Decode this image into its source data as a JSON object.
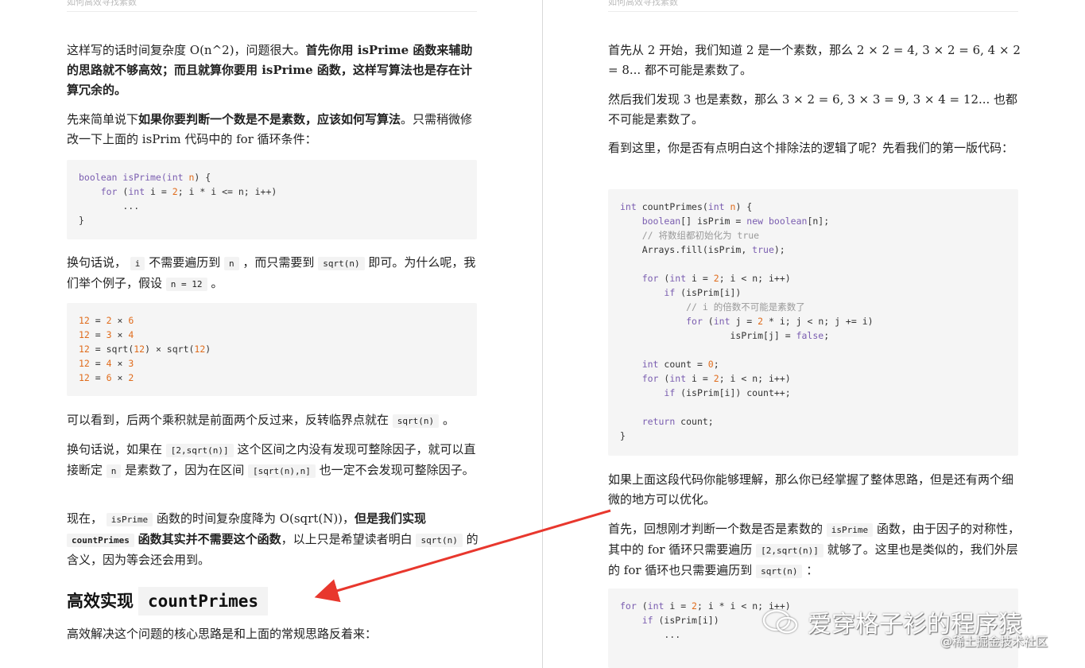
{
  "left": {
    "header": "如何高效寻找素数",
    "p1_a": "这样写的话时间复杂度 O(n^2)，问题很大。",
    "p1_b": "首先你用 isPrime 函数来辅助的思路就不够高效；而且就算你要用 isPrime 函数，这样写算法也是存在计算冗余的。",
    "p2_a": "先来简单说下",
    "p2_b": "如果你要判断一个数是不是素数，应该如何写算法",
    "p2_c": "。只需稍微修改一下上面的 isPrim 代码中的 for 循环条件：",
    "code1": {
      "l1_kw": "boolean",
      "l1_fn": " isPrime(",
      "l1_kw2": "int",
      "l1_var": " n",
      "l1_end": ") {",
      "l2_pre": "    ",
      "l2_kw": "for",
      "l2_a": " (",
      "l2_kw2": "int",
      "l2_b": " i = ",
      "l2_num": "2",
      "l2_c": "; i * i <= n; i++)",
      "l3": "        ...",
      "l4": "}"
    },
    "p3_a": "换句话说，",
    "p3_i": "i",
    "p3_b": "不需要遍历到",
    "p3_n": "n",
    "p3_c": "，而只需要到",
    "p3_sqrt": "sqrt(n)",
    "p3_d": "即可。为什么呢，我们举个例子，假设",
    "p3_eq": "n = 12",
    "p3_e": "。",
    "code2": [
      {
        "a": "12",
        "b": " = ",
        "c": "2",
        "d": " × ",
        "e": "6"
      },
      {
        "a": "12",
        "b": " = ",
        "c": "3",
        "d": " × ",
        "e": "4"
      },
      {
        "a": "12",
        "b": " = sqrt(",
        "c": "12",
        "d": ") × sqrt(",
        "e": "12",
        "f": ")"
      },
      {
        "a": "12",
        "b": " = ",
        "c": "4",
        "d": " × ",
        "e": "3"
      },
      {
        "a": "12",
        "b": " = ",
        "c": "6",
        "d": " × ",
        "e": "2"
      }
    ],
    "p4_a": "可以看到，后两个乘积就是前面两个反过来，反转临界点就在",
    "p4_sqrt": "sqrt(n)",
    "p4_b": "。",
    "p5_a": "换句话说，如果在",
    "p5_r1": "[2,sqrt(n)]",
    "p5_b": "这个区间之内没有发现可整除因子，就可以直接断定",
    "p5_n": "n",
    "p5_c": "是素数了，因为在区间",
    "p5_r2": "[sqrt(n),n]",
    "p5_d": "也一定不会发现可整除因子。",
    "p6_a": "现在，",
    "p6_isprime": "isPrime",
    "p6_b": "函数的时间复杂度降为 O(sqrt(N))，",
    "p6_c": "但是我们实现",
    "p6_cp": "countPrimes",
    "p6_d": "函数其实并不需要这个函数",
    "p6_e": "，以上只是希望读者明白",
    "p6_sqrt": "sqrt(n)",
    "p6_f": "的含义，因为等会还会用到。",
    "h2_text": "高效实现",
    "h2_code": "countPrimes",
    "p7": "高效解决这个问题的核心思路是和上面的常规思路反着来："
  },
  "right": {
    "header": "如何高效寻找素数",
    "p1": "首先从 2 开始，我们知道 2 是一个素数，那么 2 × 2 = 4, 3 × 2 = 6, 4 × 2 = 8... 都不可能是素数了。",
    "p2": "然后我们发现 3 也是素数，那么 3 × 2 = 6, 3 × 3 = 9, 3 × 4 = 12... 也都不可能是素数了。",
    "p3": "看到这里，你是否有点明白这个排除法的逻辑了呢？先看我们的第一版代码：",
    "code3_comment1": "// 将数组都初始化为 true",
    "code3_comment2": "// i 的倍数不可能是素数了",
    "p4": "如果上面这段代码你能够理解，那么你已经掌握了整体思路，但是还有两个细微的地方可以优化。",
    "p5_a": "首先，回想刚才判断一个数是否是素数的",
    "p5_isprime": "isPrime",
    "p5_b": "函数，由于因子的对称性，其中的 for 循环只需要遍历",
    "p5_range": "[2,sqrt(n)]",
    "p5_c": "就够了。这里也是类似的，我们外层的 for 循环也只需要遍历到",
    "p5_sqrt": "sqrt(n)",
    "p5_d": "："
  },
  "watermark": {
    "main": "爱穿格子衫的程序猿",
    "sub": "@稀土掘金技术社区"
  },
  "colors": {
    "keyword": "#7a5db0",
    "number": "#e06c1c",
    "comment": "#999999",
    "arrow": "#e8372d"
  }
}
